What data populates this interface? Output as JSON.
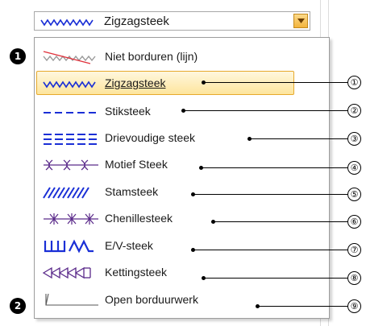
{
  "combo": {
    "value": "Zigzagsteek",
    "icon": "zigzag-stitch-icon"
  },
  "items": [
    {
      "label": "Niet borduren (lijn)",
      "icon": "no-embroidery-icon"
    },
    {
      "label": "Zigzagsteek",
      "icon": "zigzag-stitch-icon",
      "selected": true
    },
    {
      "label": "Stiksteek",
      "icon": "running-stitch-icon"
    },
    {
      "label": "Drievoudige steek",
      "icon": "triple-stitch-icon"
    },
    {
      "label": "Motief Steek",
      "icon": "motif-stitch-icon"
    },
    {
      "label": "Stamsteek",
      "icon": "stem-stitch-icon"
    },
    {
      "label": "Chenillesteek",
      "icon": "chenille-stitch-icon"
    },
    {
      "label": "E/V-steek",
      "icon": "ev-stitch-icon"
    },
    {
      "label": "Kettingsteek",
      "icon": "chain-stitch-icon"
    },
    {
      "label": "Open borduurwerk",
      "icon": "open-embroidery-icon"
    }
  ],
  "callouts": [
    "①",
    "②",
    "③",
    "④",
    "⑤",
    "⑥",
    "⑦",
    "⑧",
    "⑨"
  ],
  "badges": [
    "1",
    "2"
  ],
  "colors": {
    "stitch_blue": "#1a2fd6",
    "stitch_purple": "#5a2a8a",
    "no_embroidery_red": "#e0303a",
    "selection_border": "#e6a92c",
    "arrow_button": "#f3b43c"
  }
}
